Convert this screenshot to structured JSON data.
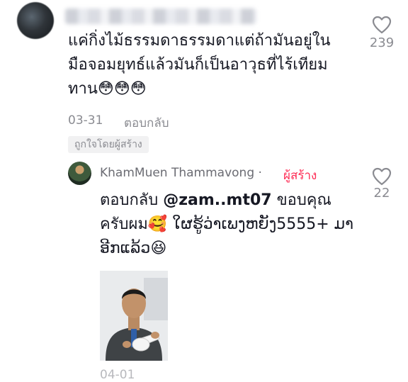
{
  "comment": {
    "text": "แค่กิ่งไม้ธรรมดาธรรมดาแต่ถ้ามันอยู่ในมือจอมยุทธ์แล้วมันก็เป็นอาวุธที่ไร้เทียมทาน😳😳😳",
    "date": "03-31",
    "reply_label": "ตอบกลับ",
    "creator_liked_badge": "ถูกใจโดยผู้สร้าง",
    "like_count": "239"
  },
  "reply": {
    "author": "KhamMuen Thammavong",
    "separator": "·",
    "creator_label": "ผู้สร้าง",
    "prefix": "ตอบกลับ ",
    "mention": "@zam..mt07",
    "text": " ขอบคุณครับผม🥰 ໃຜຮູ້ວ່າເພງຫຍັງ5555+ ມາອີກແລ້ວ😆",
    "date": "04-01",
    "like_count": "22"
  },
  "icons": {
    "like": "heart-outline-icon"
  },
  "colors": {
    "creator_accent": "#fe2c55",
    "meta_gray": "#8a8b91"
  }
}
